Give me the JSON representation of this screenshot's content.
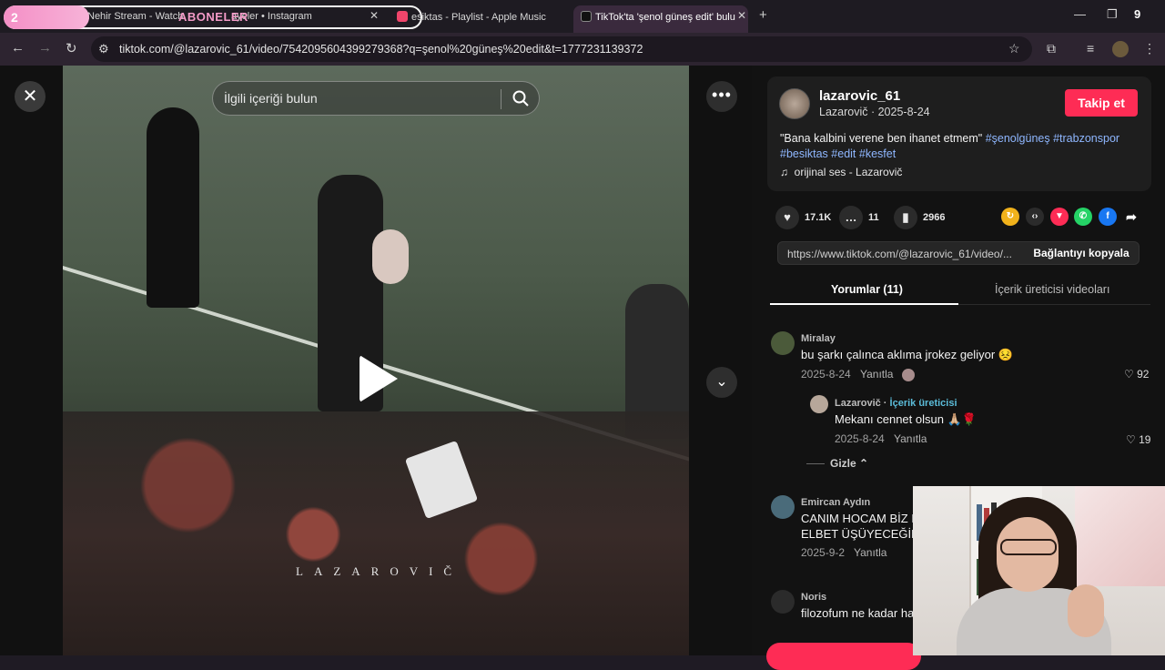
{
  "browser": {
    "overlay_badge": "2",
    "overlay_title": "ABONELER",
    "tabs": [
      {
        "label": "Nehir Stream - Watch"
      },
      {
        "label": "ayeler • Instagram"
      },
      {
        "label": "esiktas - Playlist - Apple Music"
      },
      {
        "label": "TikTok'ta 'şenol güneş edit' bulu"
      }
    ],
    "new_tab": "+",
    "window_badge": "9",
    "url": "tiktok.com/@lazarovic_61/video/7542095604399279368?q=şenol%20güneş%20edit&t=1777231139372"
  },
  "video": {
    "search_placeholder": "İlgili içeriği bulun",
    "watermark": "LAZAROVIČ"
  },
  "post": {
    "username": "lazarovic_61",
    "subline": "Lazarovič · 2025-8-24",
    "follow_label": "Takip et",
    "caption_text": "\"Bana kalbini verene ben ihanet etmem\"",
    "hashtags": [
      "#şenolgüneş",
      "#trabzonspor",
      "#besiktas",
      "#edit",
      "#kesfet"
    ],
    "music": "orijinal ses - Lazarovič",
    "likes": "17.1K",
    "comments": "11",
    "saves": "2966",
    "link": "https://www.tiktok.com/@lazarovic_61/video/...",
    "copy_label": "Bağlantıyı kopyala"
  },
  "panel_tabs": [
    {
      "label": "Yorumlar (11)"
    },
    {
      "label": "İçerik üreticisi videoları"
    }
  ],
  "comments": [
    {
      "name": "Miralay",
      "text": "bu şarkı çalınca aklıma jrokez geliyor 😣",
      "date": "2025-8-24",
      "reply": "Yanıtla",
      "likes": "92"
    },
    {
      "name": "Lazarovič",
      "badge": "İçerik üreticisi",
      "text": "Mekanı cennet olsun 🙏🏼🌹",
      "date": "2025-8-24",
      "reply": "Yanıtla",
      "likes": "19"
    },
    {
      "name": "Emircan Aydın",
      "text": "CANIM HOCAM BİZ B",
      "text2": "ELBET ÜŞÜYECEĞİNİ",
      "date": "2025-9-2",
      "reply": "Yanıtla"
    },
    {
      "name": "Noris",
      "text": "filozofum ne kadar ha"
    }
  ],
  "hide_label": "Gizle",
  "colors": {
    "accent": "#fe2c55",
    "hashtag": "#8fb7ff",
    "creator": "#5bbcd9"
  }
}
